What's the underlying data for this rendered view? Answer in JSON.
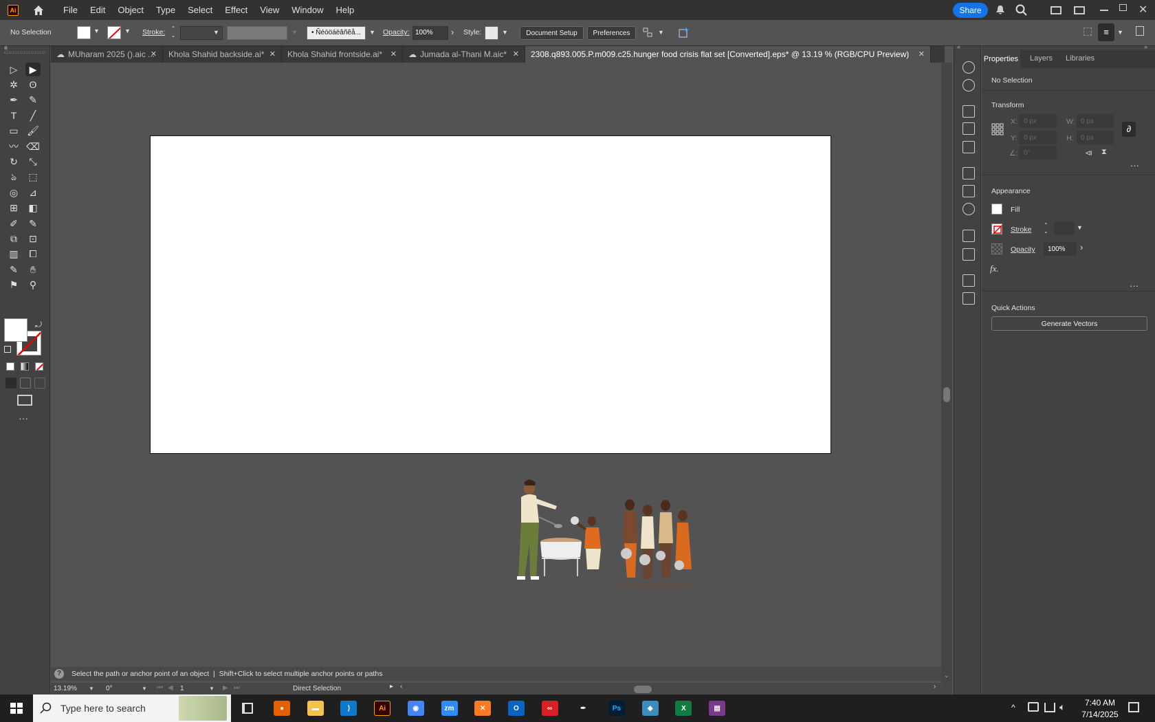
{
  "app": {
    "logo": "Ai",
    "brand_color": "#ff9a00"
  },
  "menu": [
    "File",
    "Edit",
    "Object",
    "Type",
    "Select",
    "Effect",
    "View",
    "Window",
    "Help"
  ],
  "topright": {
    "share_label": "Share",
    "share_color": "#1473e6"
  },
  "control": {
    "selection_label": "No Selection",
    "stroke_label": "Stroke:",
    "brush_label": "Ñéòöáëâñêå...",
    "opacity_label": "Opacity:",
    "opacity_value": "100%",
    "style_label": "Style:",
    "document_setup": "Document Setup",
    "preferences": "Preferences"
  },
  "tabs": [
    {
      "label": "MUharam 2025 ().aic ...",
      "cloud": true
    },
    {
      "label": "Khola Shahid backside.ai*",
      "cloud": false
    },
    {
      "label": "Khola Shahid frontside.ai*",
      "cloud": false
    },
    {
      "label": "Jumada al-Thani M.aic*",
      "cloud": true
    },
    {
      "label": "2308.q893.005.P.m009.c25.hunger food crisis flat set [Converted].eps* @ 13.19 % (RGB/CPU Preview)",
      "cloud": false
    }
  ],
  "panel": {
    "tabs": [
      "Properties",
      "Layers",
      "Libraries"
    ],
    "selection": "No Selection",
    "transform_title": "Transform",
    "x_label": "X:",
    "y_label": "Y:",
    "w_label": "W:",
    "h_label": "H:",
    "x_val": "0 px",
    "y_val": "0 px",
    "w_val": "0 px",
    "h_val": "0 px",
    "angle_label": "∠:",
    "angle_val": "0°",
    "appearance_title": "Appearance",
    "fill_label": "Fill",
    "stroke_label": "Stroke",
    "opacity_label": "Opacity",
    "opacity_val": "100%",
    "fx_label": "fx.",
    "quick_actions_title": "Quick Actions",
    "generate_vectors": "Generate Vectors"
  },
  "status": {
    "hint": "Select the path or anchor point of an object  |  Shift+Click to select multiple anchor points or paths"
  },
  "bottom": {
    "zoom": "13.19%",
    "rotate": "0°",
    "artboard": "1",
    "tool": "Direct Selection"
  },
  "taskbar": {
    "search_placeholder": "Type here to search",
    "time": "7:40 AM",
    "date": "7/14/2025",
    "apps": [
      "firefox",
      "file-explorer",
      "vscode",
      "illustrator",
      "chrome",
      "zoom",
      "xampp",
      "outlook",
      "creative-cloud",
      "pen",
      "photoshop",
      "sketch",
      "excel",
      "winrar"
    ]
  }
}
